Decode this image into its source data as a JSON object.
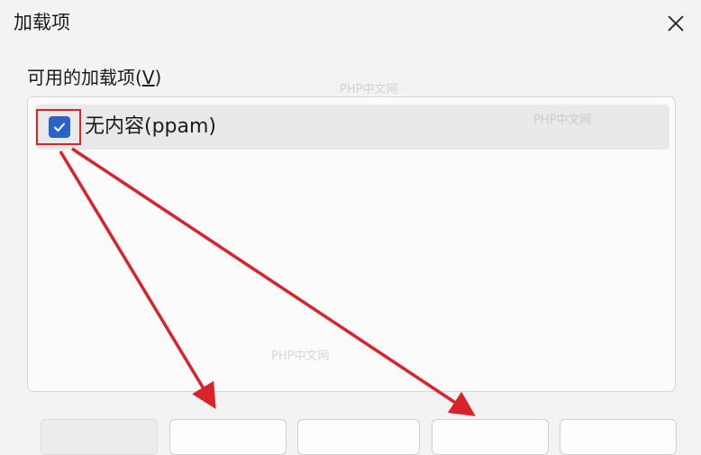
{
  "dialog": {
    "title": "加载项",
    "close_icon": "close-icon"
  },
  "section": {
    "label_prefix": "可用的加载项(",
    "label_mnemonic": "V",
    "label_suffix": ")"
  },
  "addins": [
    {
      "label": "无内容(ppam)",
      "checked": true
    }
  ],
  "watermarks": {
    "text_1": "PHP中文网",
    "text_2": "PHP中文网",
    "text_3": "PHP中文网"
  },
  "colors": {
    "checkbox": "#2a63c4",
    "annotation": "#d9222a"
  }
}
